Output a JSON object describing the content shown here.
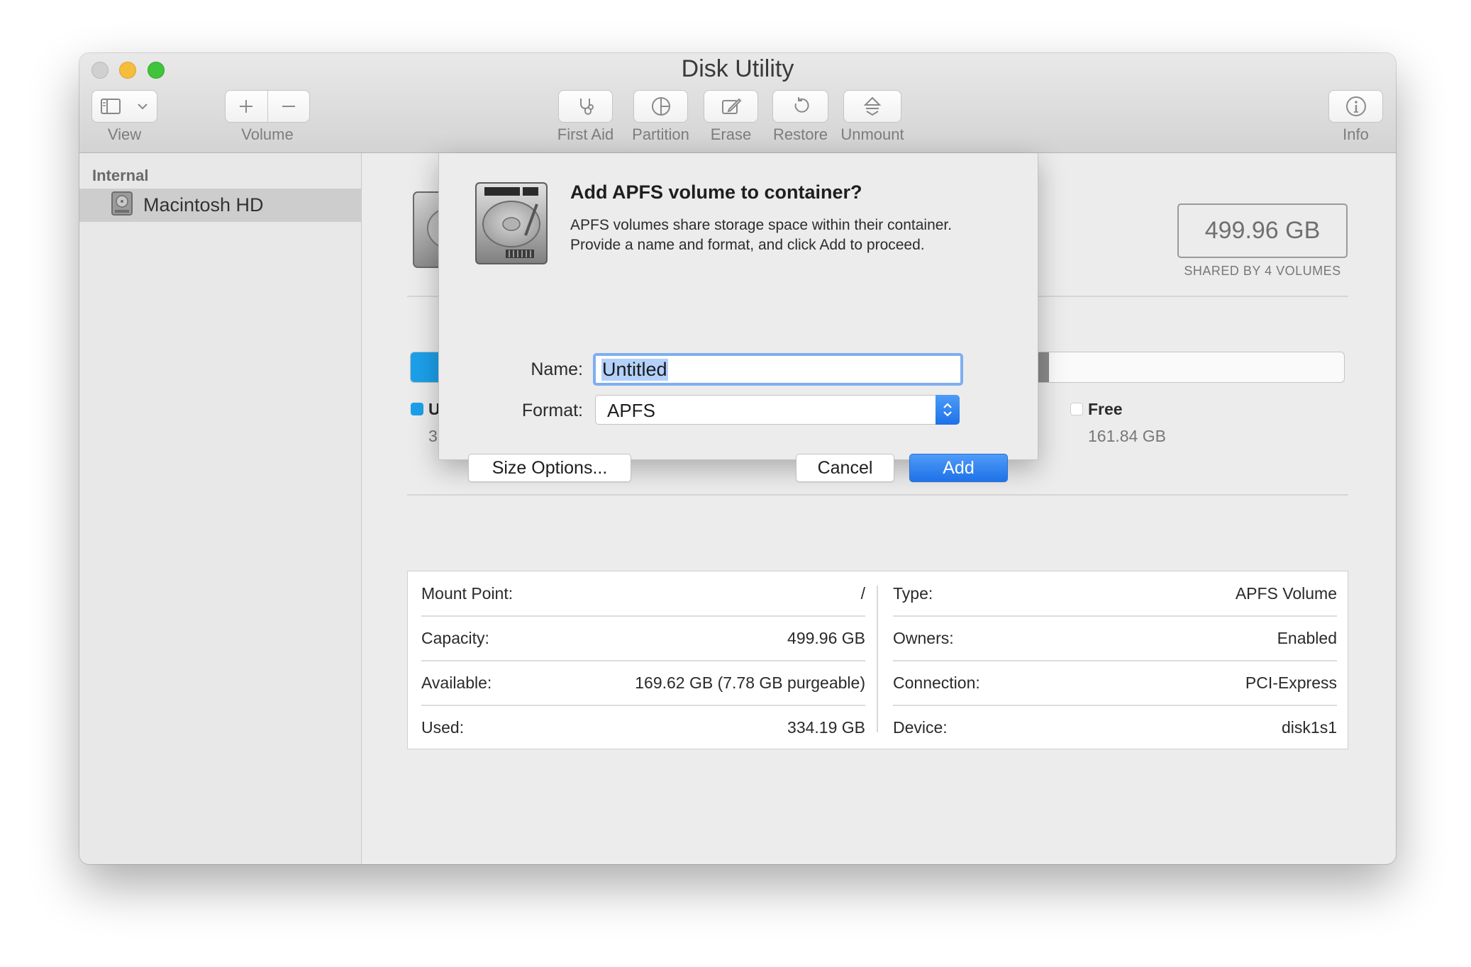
{
  "window": {
    "title": "Disk Utility"
  },
  "toolbar": {
    "view_label": "View",
    "volume_label": "Volume",
    "first_aid_label": "First Aid",
    "partition_label": "Partition",
    "erase_label": "Erase",
    "restore_label": "Restore",
    "unmount_label": "Unmount",
    "info_label": "Info"
  },
  "sidebar": {
    "section": "Internal",
    "items": [
      {
        "label": "Macintosh HD",
        "selected": true
      }
    ]
  },
  "volume": {
    "capacity": "499.96 GB",
    "shared_caption": "SHARED BY 4 VOLUMES",
    "used_fraction": 0.668,
    "purgeable_fraction": 0.016,
    "legend": {
      "used_initial": "U",
      "used_value_initial": "3",
      "free_label": "Free",
      "free_value": "161.84 GB"
    },
    "colors": {
      "used": "#1ca0ea",
      "purgeable": "#8c8c8c",
      "free": "#fafafa"
    }
  },
  "info": {
    "left": [
      {
        "key": "Mount Point:",
        "value": "/"
      },
      {
        "key": "Capacity:",
        "value": "499.96 GB"
      },
      {
        "key": "Available:",
        "value": "169.62 GB (7.78 GB purgeable)"
      },
      {
        "key": "Used:",
        "value": "334.19 GB"
      }
    ],
    "right": [
      {
        "key": "Type:",
        "value": "APFS Volume"
      },
      {
        "key": "Owners:",
        "value": "Enabled"
      },
      {
        "key": "Connection:",
        "value": "PCI-Express"
      },
      {
        "key": "Device:",
        "value": "disk1s1"
      }
    ]
  },
  "dialog": {
    "title": "Add APFS volume to container?",
    "message_line1": "APFS volumes share storage space within their container.",
    "message_line2": "Provide a name and format, and click Add to proceed.",
    "name_label": "Name:",
    "name_value": "Untitled",
    "format_label": "Format:",
    "format_value": "APFS",
    "size_options_label": "Size Options...",
    "cancel_label": "Cancel",
    "add_label": "Add",
    "accent_color": "#1f72e8"
  }
}
